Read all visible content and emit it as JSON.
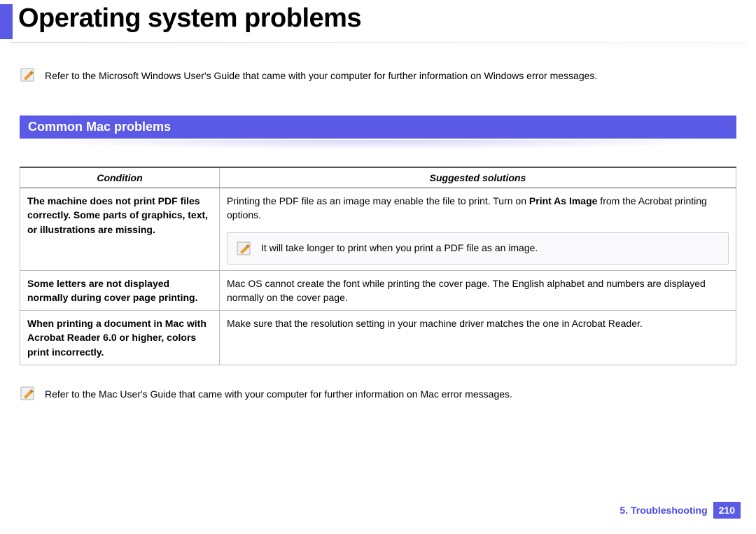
{
  "title": "Operating system problems",
  "top_note": "Refer to the Microsoft Windows User's Guide that came with your computer for further information on Windows error messages.",
  "section_heading": "Common Mac problems",
  "table": {
    "headers": {
      "condition": "Condition",
      "solutions": "Suggested solutions"
    },
    "rows": [
      {
        "condition": "The machine does not print PDF files correctly. Some parts of graphics, text, or illustrations are missing.",
        "solution_pre": "Printing the PDF file as an image may enable the file to print. Turn on ",
        "solution_bold": "Print As Image",
        "solution_post": " from the Acrobat printing options.",
        "inner_note": "It will take longer to print when you print a PDF file as an image."
      },
      {
        "condition": "Some letters are not displayed normally during cover page printing.",
        "solution": "Mac OS cannot create the font while printing the cover page. The English alphabet and numbers are displayed normally on the cover page."
      },
      {
        "condition": "When printing a document in Mac with Acrobat Reader 6.0 or higher, colors print incorrectly.",
        "solution": "Make sure that the resolution setting in your machine driver matches the one in Acrobat Reader."
      }
    ]
  },
  "bottom_note": "Refer to the Mac User's Guide that came with your computer for further information on Mac error messages.",
  "footer": {
    "chapter": "5.  Troubleshooting",
    "page": "210"
  }
}
